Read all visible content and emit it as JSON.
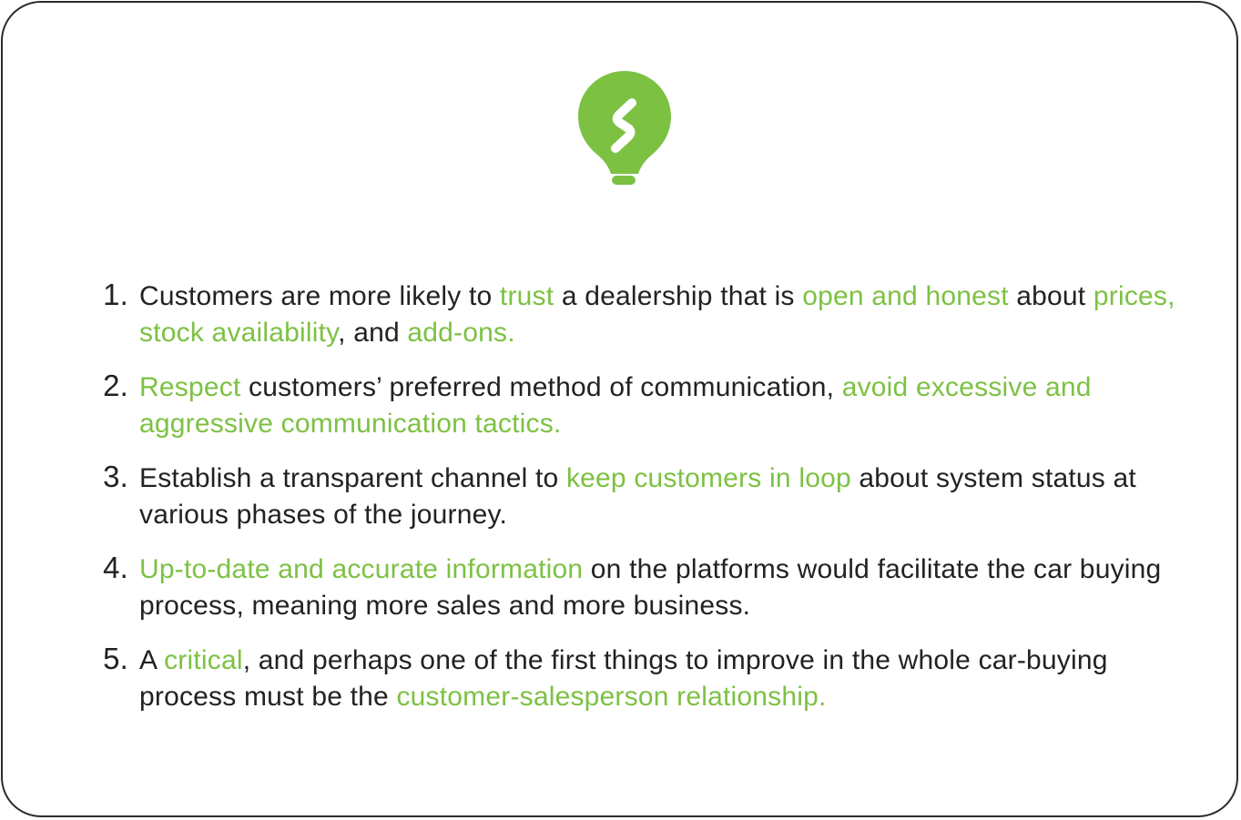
{
  "colors": {
    "accent": "#7dc143",
    "text": "#222222",
    "border": "#2b2b2b",
    "background": "#ffffff"
  },
  "icon": "lightbulb-icon",
  "insights": [
    {
      "number": "1.",
      "segments": [
        {
          "text": "Customers are more likely to ",
          "hl": false
        },
        {
          "text": "trust",
          "hl": true
        },
        {
          "text": " a dealership that is ",
          "hl": false
        },
        {
          "text": "open and honest",
          "hl": true
        },
        {
          "text": " about ",
          "hl": false
        },
        {
          "text": "prices, stock availability",
          "hl": true
        },
        {
          "text": ", and ",
          "hl": false
        },
        {
          "text": "add-ons.",
          "hl": true
        }
      ]
    },
    {
      "number": "2.",
      "segments": [
        {
          "text": "Respect",
          "hl": true
        },
        {
          "text": " customers’ preferred method of communication, ",
          "hl": false
        },
        {
          "text": "avoid excessive and aggressive communication tactics.",
          "hl": true
        }
      ]
    },
    {
      "number": "3.",
      "segments": [
        {
          "text": "Establish a transparent channel to ",
          "hl": false
        },
        {
          "text": "keep customers in loop",
          "hl": true
        },
        {
          "text": " about system status at various phases of the journey.",
          "hl": false
        }
      ]
    },
    {
      "number": "4.",
      "segments": [
        {
          "text": "Up-to-date and accurate information",
          "hl": true
        },
        {
          "text": " on the platforms would facilitate the car buying process, meaning more sales and more business.",
          "hl": false
        }
      ]
    },
    {
      "number": "5.",
      "segments": [
        {
          "text": "A ",
          "hl": false
        },
        {
          "text": "critical",
          "hl": true
        },
        {
          "text": ", and perhaps one of the first things to improve in the whole car-buying process must be the ",
          "hl": false
        },
        {
          "text": "customer-salesperson relationship.",
          "hl": true
        }
      ]
    }
  ]
}
